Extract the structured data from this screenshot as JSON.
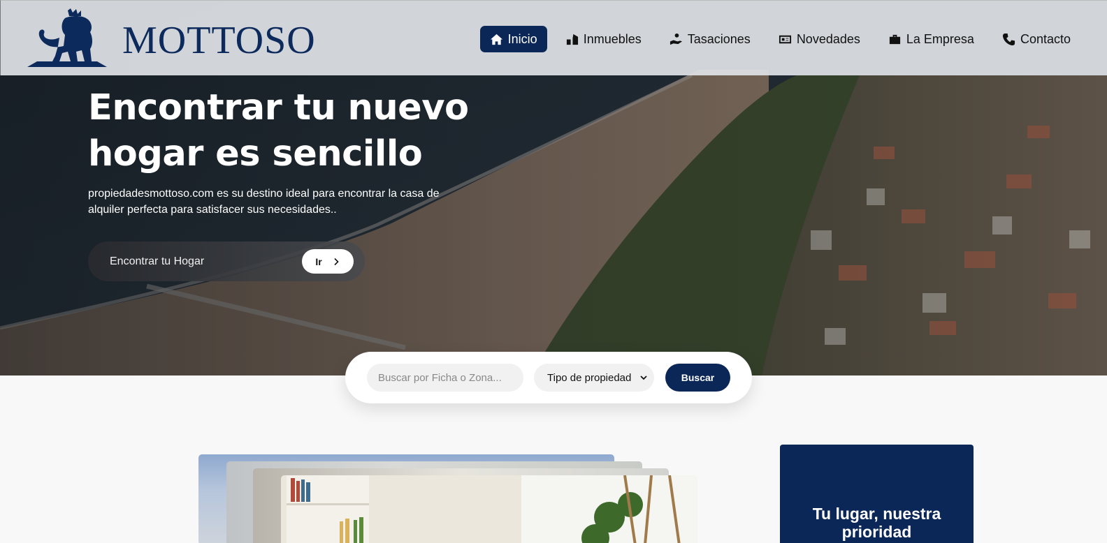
{
  "brand": {
    "name": "MOTTOSO",
    "logo_icon": "lion-crest-icon"
  },
  "nav": {
    "items": [
      {
        "label": "Inicio",
        "icon": "home-icon",
        "active": true
      },
      {
        "label": "Inmuebles",
        "icon": "property-icon",
        "active": false
      },
      {
        "label": "Tasaciones",
        "icon": "hand-coins-icon",
        "active": false
      },
      {
        "label": "Novedades",
        "icon": "newspaper-icon",
        "active": false
      },
      {
        "label": "La Empresa",
        "icon": "briefcase-icon",
        "active": false
      },
      {
        "label": "Contacto",
        "icon": "phone-icon",
        "active": false
      }
    ]
  },
  "hero": {
    "title": "Encontrar tu nuevo hogar es sencillo",
    "subtitle": "propiedadesmottoso.com es su destino ideal para encontrar la casa de alquiler perfecta para satisfacer sus necesidades..",
    "cta_label": "Encontrar tu Hogar",
    "cta_button": "Ir"
  },
  "search": {
    "placeholder": "Buscar por Ficha o Zona...",
    "property_type_selected": "Tipo de propiedad",
    "button_label": "Buscar"
  },
  "promo": {
    "title": "Tu lugar, nuestra prioridad"
  },
  "colors": {
    "primary": "#0b2758",
    "header_bg": "#e1e4e8"
  }
}
